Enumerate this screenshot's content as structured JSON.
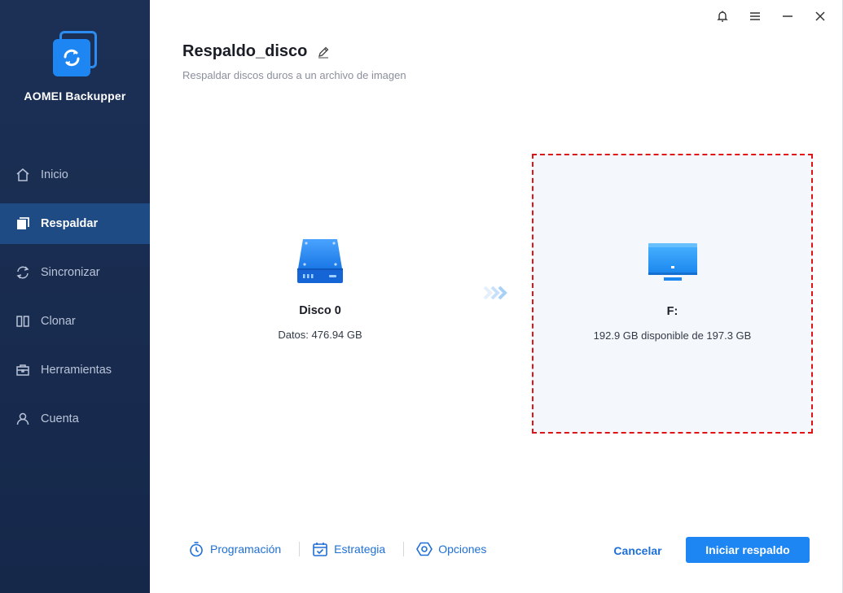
{
  "app": {
    "name": "AOMEI Backupper"
  },
  "sidebar": {
    "items": [
      {
        "label": "Inicio",
        "icon": "home-icon",
        "active": false
      },
      {
        "label": "Respaldar",
        "icon": "backup-icon",
        "active": true
      },
      {
        "label": "Sincronizar",
        "icon": "sync-icon",
        "active": false
      },
      {
        "label": "Clonar",
        "icon": "clone-icon",
        "active": false
      },
      {
        "label": "Herramientas",
        "icon": "toolbox-icon",
        "active": false
      },
      {
        "label": "Cuenta",
        "icon": "user-icon",
        "active": false
      }
    ]
  },
  "header": {
    "title": "Respaldo_disco",
    "subtitle": "Respaldar discos duros a un archivo de imagen"
  },
  "source": {
    "name": "Disco 0",
    "info": "Datos: 476.94 GB"
  },
  "destination": {
    "name": "F:",
    "info": "192.9 GB disponible de 197.3 GB"
  },
  "bottom": {
    "schedule": "Programación",
    "strategy": "Estrategia",
    "options": "Opciones",
    "cancel": "Cancelar",
    "start": "Iniciar respaldo"
  },
  "colors": {
    "sidebar_bg": "#1c3056",
    "sidebar_active": "#1f4b84",
    "accent": "#1e86f2",
    "link": "#1e6fd6",
    "highlight_border": "#e01414"
  }
}
